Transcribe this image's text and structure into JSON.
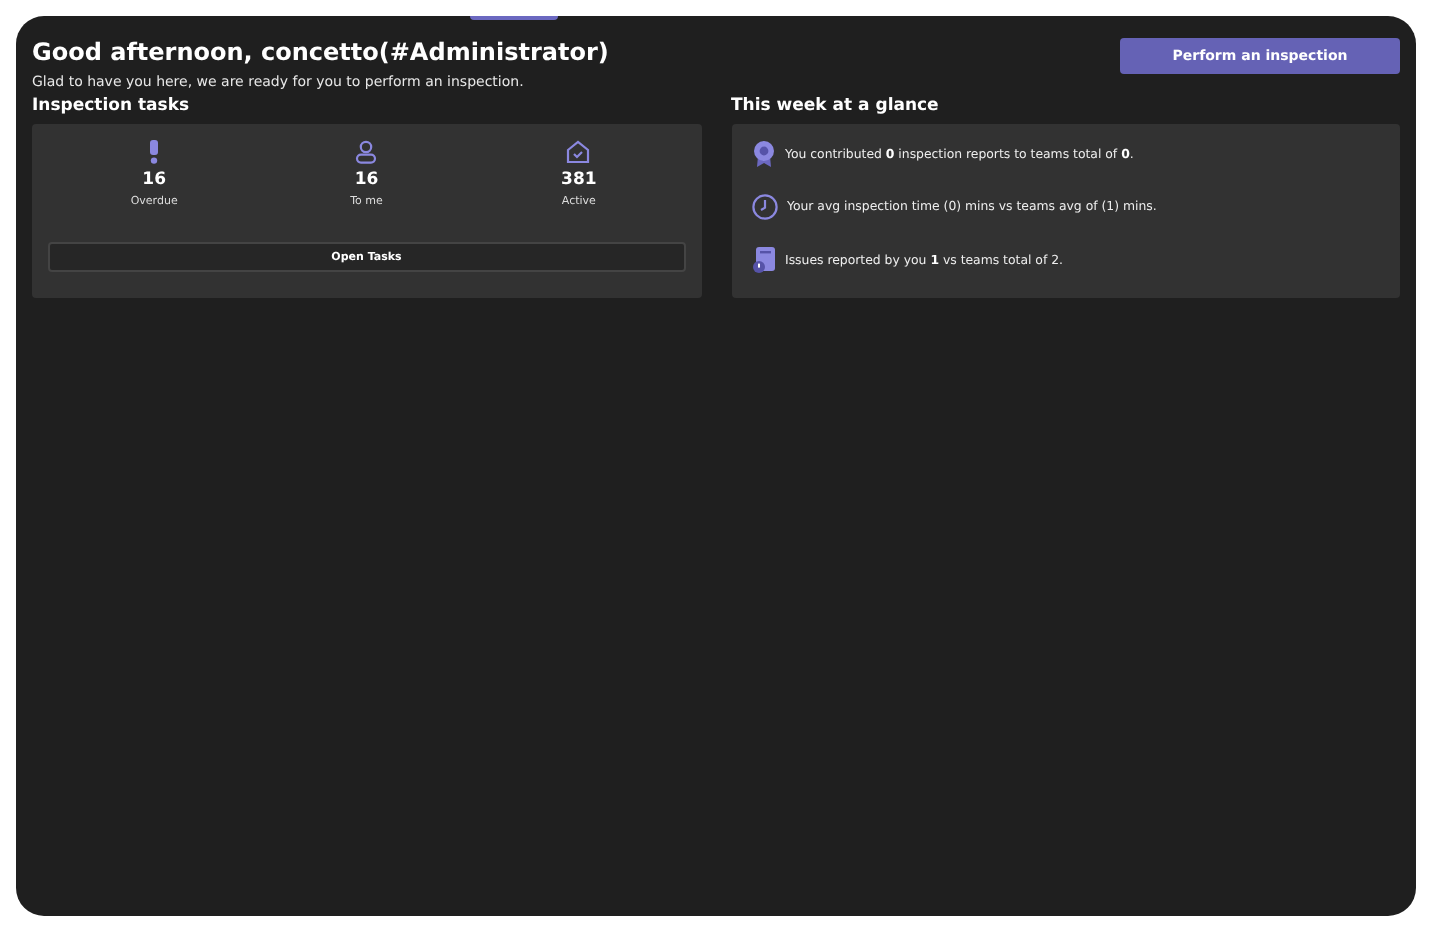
{
  "greeting": {
    "title": "Good afternoon, concetto(#Administrator)",
    "subtitle": "Glad to have you here, we are ready for you to perform an inspection."
  },
  "primary_button": "Perform an inspection",
  "inspection_tasks": {
    "heading": "Inspection tasks",
    "stats": [
      {
        "kind": "alert",
        "count": "16",
        "label": "Overdue"
      },
      {
        "kind": "person",
        "count": "16",
        "label": "To me"
      },
      {
        "kind": "active",
        "count": "381",
        "label": "Active"
      }
    ],
    "button": "Open Tasks"
  },
  "week_glance": {
    "heading": "This week at a glance",
    "items": [
      {
        "kind": "award",
        "text": "You contributed **0** inspection reports to teams total of **0**."
      },
      {
        "kind": "clock",
        "text": "Your avg inspection time (0) mins vs teams avg of (1) mins."
      },
      {
        "kind": "issue",
        "text": "Issues reported by you **1** vs teams total of 2."
      }
    ]
  }
}
